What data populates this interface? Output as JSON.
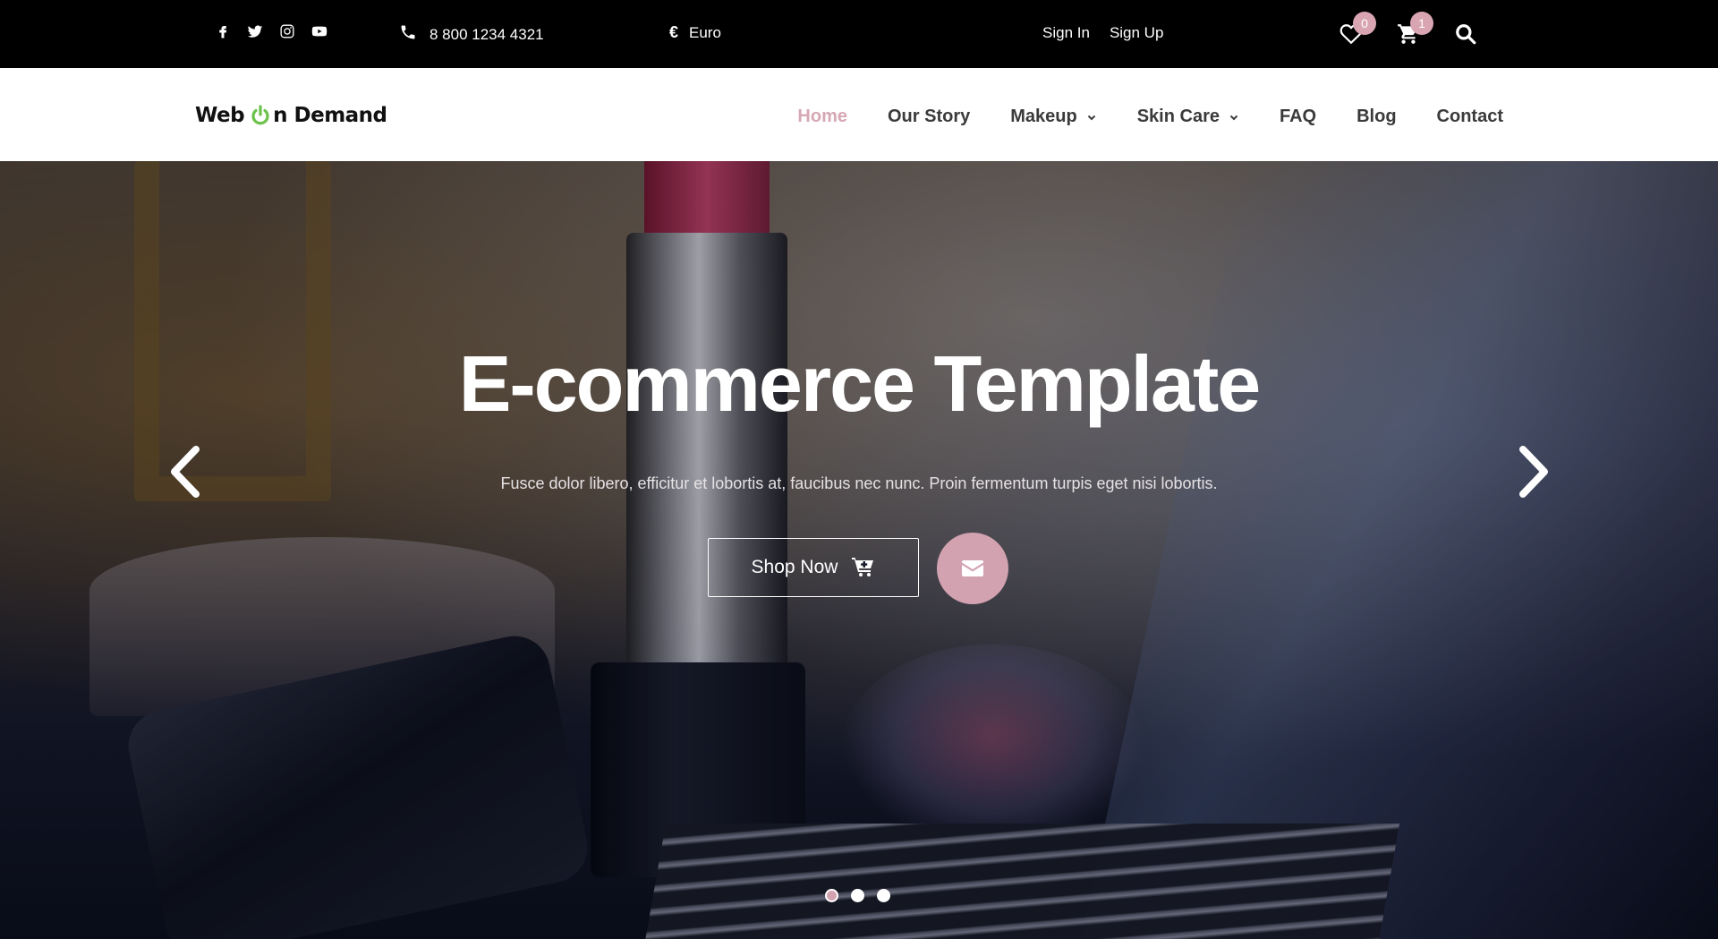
{
  "topbar": {
    "social": [
      {
        "name": "facebook-icon"
      },
      {
        "name": "twitter-icon"
      },
      {
        "name": "instagram-icon"
      },
      {
        "name": "youtube-icon"
      }
    ],
    "phone": "8 800 1234 4321",
    "currency_symbol": "€",
    "currency": "Euro",
    "sign_in": "Sign In",
    "sign_up": "Sign Up",
    "wishlist_count": "0",
    "cart_count": "1"
  },
  "header": {
    "logo_part1": "Web",
    "logo_part2": "n Demand",
    "nav": [
      {
        "label": "Home",
        "active": true
      },
      {
        "label": "Our Story"
      },
      {
        "label": "Makeup",
        "dropdown": true
      },
      {
        "label": "Skin Care",
        "dropdown": true
      },
      {
        "label": "FAQ"
      },
      {
        "label": "Blog"
      },
      {
        "label": "Contact"
      }
    ]
  },
  "hero": {
    "title": "E-commerce Template",
    "subtitle": "Fusce dolor libero, efficitur et lobortis at, faucibus nec nunc. Proin fermentum turpis eget nisi lobortis.",
    "shop_label": "Shop Now",
    "slides": 3,
    "active_slide": 1
  },
  "colors": {
    "accent": "#d3a2b1",
    "topbar_bg": "#000000",
    "nav_text": "#3a3a3a",
    "logo_green": "#6cc24a"
  }
}
